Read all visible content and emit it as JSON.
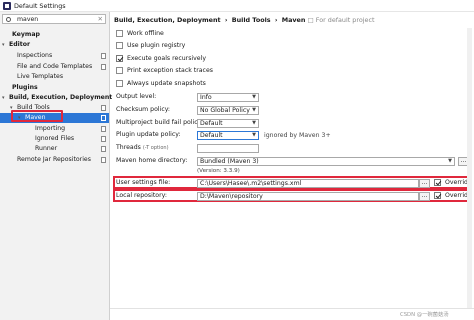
{
  "window": {
    "title": "Default Settings"
  },
  "search": {
    "value": "maven"
  },
  "tree": [
    {
      "label": "Keymap",
      "bold": true,
      "indent": 0,
      "arrow": "",
      "page": false
    },
    {
      "label": "Editor",
      "bold": true,
      "indent": 0,
      "arrow": "▾",
      "page": false
    },
    {
      "label": "Inspections",
      "bold": false,
      "indent": 1,
      "arrow": "",
      "page": true
    },
    {
      "label": "File and Code Templates",
      "bold": false,
      "indent": 1,
      "arrow": "",
      "page": true
    },
    {
      "label": "Live Templates",
      "bold": false,
      "indent": 1,
      "arrow": "",
      "page": false
    },
    {
      "label": "Plugins",
      "bold": true,
      "indent": 0,
      "arrow": "",
      "page": false
    },
    {
      "label": "Build, Execution, Deployment",
      "bold": true,
      "indent": 0,
      "arrow": "▾",
      "page": false
    },
    {
      "label": "Build Tools",
      "bold": false,
      "indent": 1,
      "arrow": "▾",
      "page": true
    },
    {
      "label": "Maven",
      "bold": false,
      "indent": 2,
      "arrow": "▾",
      "page": true,
      "selected": true
    },
    {
      "label": "Importing",
      "bold": false,
      "indent": 3,
      "arrow": "",
      "page": true
    },
    {
      "label": "Ignored Files",
      "bold": false,
      "indent": 3,
      "arrow": "",
      "page": true
    },
    {
      "label": "Runner",
      "bold": false,
      "indent": 3,
      "arrow": "",
      "page": true
    },
    {
      "label": "Remote Jar Repositories",
      "bold": false,
      "indent": 1,
      "arrow": "",
      "page": true
    }
  ],
  "breadcrumb": {
    "part1": "Build, Execution, Deployment",
    "sep": "›",
    "part2": "Build Tools",
    "part3": "Maven",
    "note": "For default project"
  },
  "checkboxes": [
    {
      "label": "Work offline",
      "checked": false
    },
    {
      "label": "Use plugin registry",
      "checked": false
    },
    {
      "label": "Execute goals recursively",
      "checked": true
    },
    {
      "label": "Print exception stack traces",
      "checked": false
    },
    {
      "label": "Always update snapshots",
      "checked": false
    }
  ],
  "form": {
    "output_level": {
      "label": "Output level:",
      "value": "Info"
    },
    "checksum_policy": {
      "label": "Checksum policy:",
      "value": "No Global Policy"
    },
    "fail_policy": {
      "label": "Multiproject build fail policy:",
      "value": "Default"
    },
    "plugin_update": {
      "label": "Plugin update policy:",
      "value": "Default",
      "note": "ignored by Maven 3+"
    },
    "threads": {
      "label": "Threads",
      "hint": "(-T option)",
      "value": ""
    },
    "maven_home": {
      "label": "Maven home directory:",
      "value": "Bundled (Maven 3)",
      "version": "(Version: 3.3.9)"
    },
    "user_settings": {
      "label": "User settings file:",
      "value": "C:\\Users\\Hasee\\.m2\\settings.xml",
      "override": "Override",
      "browse": "..."
    },
    "local_repo": {
      "label": "Local repository:",
      "value": "D:\\Maven\\repository",
      "override": "Override",
      "browse": "..."
    }
  },
  "watermark": "CSDN @一碗菌菇汤"
}
